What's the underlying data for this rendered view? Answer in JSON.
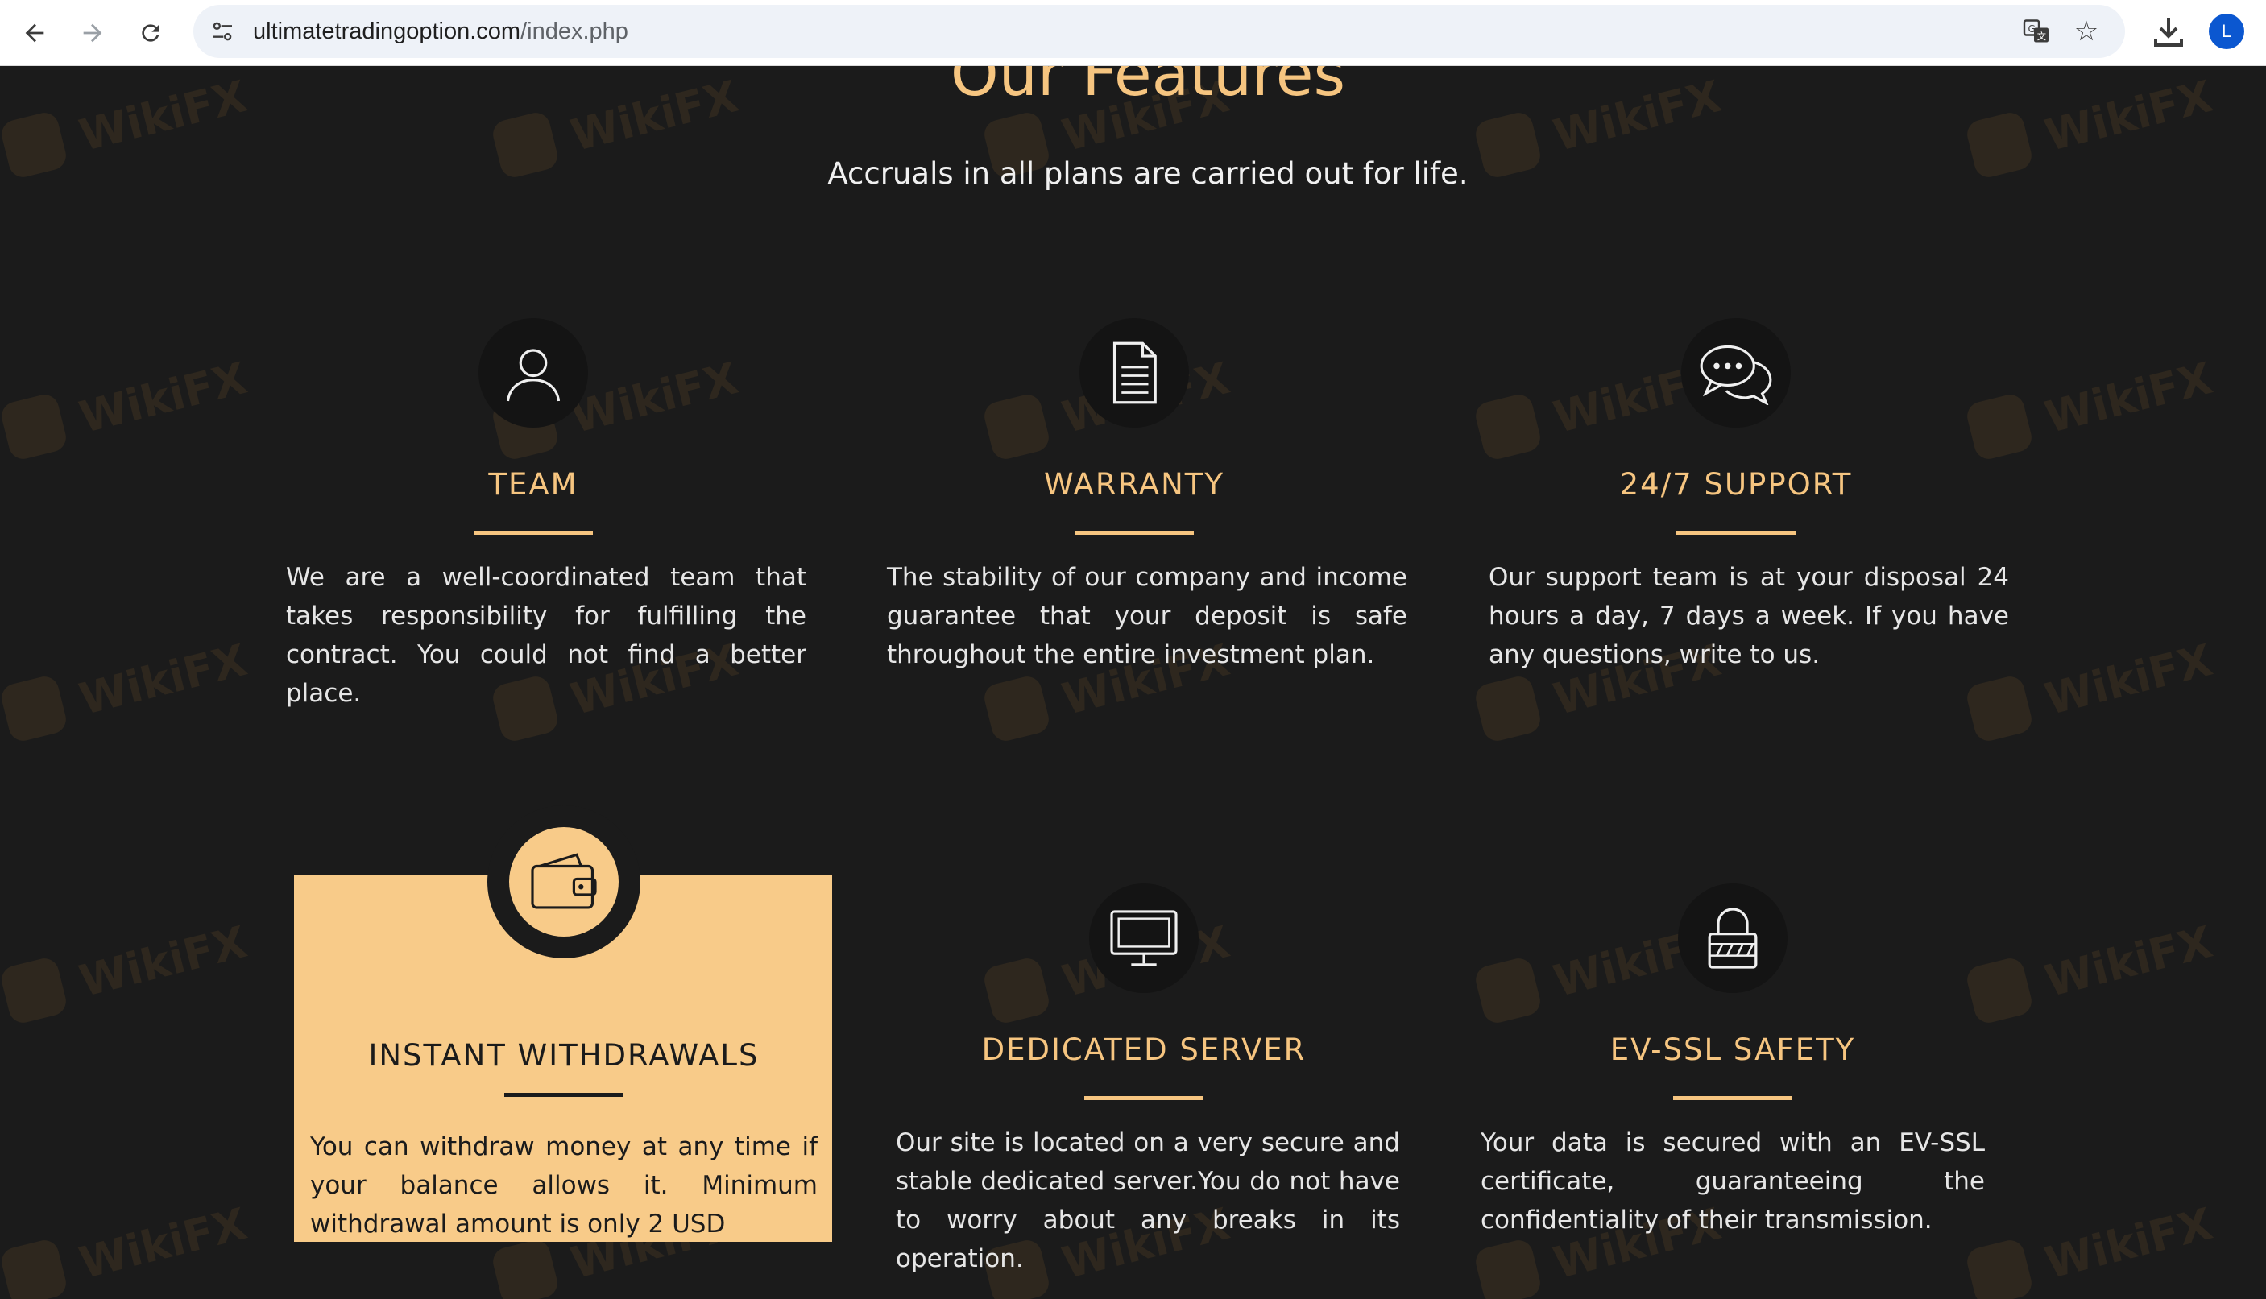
{
  "browser": {
    "url_host": "ultimatetradingoption.com",
    "url_path": "/index.php",
    "profile_initial": "L"
  },
  "section": {
    "title": "Our Features",
    "subtitle": "Accruals in all plans are carried out for life."
  },
  "watermark": {
    "text": "WikiFX"
  },
  "features": [
    {
      "icon": "user-icon",
      "title": "TEAM",
      "text": "We are a well-coordinated team that takes responsibility for fulfilling the contract. You could not find a better place."
    },
    {
      "icon": "document-icon",
      "title": "WARRANTY",
      "text": "The stability of our company and income guarantee that your deposit is safe throughout the entire investment plan."
    },
    {
      "icon": "chat-bubbles-icon",
      "title": "24/7 SUPPORT",
      "text": "Our support team is at your disposal 24 hours a day, 7 days a week. If you have any questions, write to us."
    },
    {
      "icon": "wallet-icon",
      "title": "INSTANT WITHDRAWALS",
      "text": "You can withdraw money at any time if your balance allows it. Minimum withdrawal amount is only 2 USD"
    },
    {
      "icon": "monitor-icon",
      "title": "DEDICATED SERVER",
      "text": "Our site is located on a very secure and stable dedicated server.You do not have to worry about any breaks in its operation."
    },
    {
      "icon": "lock-icon",
      "title": "EV-SSL SAFETY",
      "text": "Your data is secured with an EV-SSL certificate, guaranteeing the confidentiality of their transmission."
    }
  ],
  "colors": {
    "accent": "#f6c580",
    "background": "#1b1b1b",
    "active_panel": "#f8cb89"
  }
}
